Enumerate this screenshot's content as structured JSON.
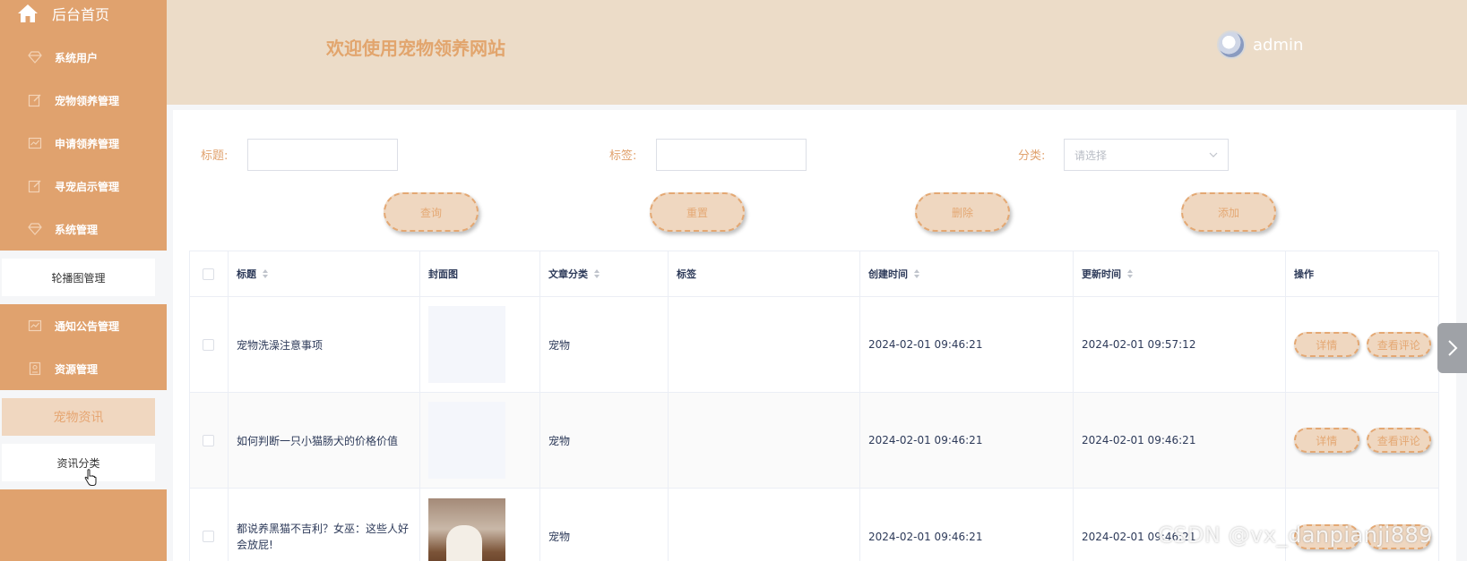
{
  "sidebar": {
    "home": "后台首页",
    "items": [
      {
        "label": "系统用户",
        "icon": "diamond-icon"
      },
      {
        "label": "宠物领养管理",
        "icon": "edit-icon"
      },
      {
        "label": "申请领养管理",
        "icon": "chart-icon"
      },
      {
        "label": "寻宠启示管理",
        "icon": "edit-icon"
      },
      {
        "label": "系统管理",
        "icon": "diamond-icon"
      },
      {
        "label": "通知公告管理",
        "icon": "chart-icon"
      },
      {
        "label": "资源管理",
        "icon": "badge-icon"
      }
    ],
    "sub_carousel": "轮播图管理",
    "sub_active": "宠物资讯",
    "sub_category": "资讯分类"
  },
  "header": {
    "title": "欢迎使用宠物领养网站",
    "username": "admin"
  },
  "filters": {
    "title_label": "标题:",
    "tag_label": "标签:",
    "category_label": "分类:",
    "category_placeholder": "请选择"
  },
  "buttons": {
    "query": "查询",
    "reset": "重置",
    "delete": "删除",
    "add": "添加"
  },
  "table": {
    "headers": {
      "title": "标题",
      "cover": "封面图",
      "category": "文章分类",
      "tags": "标签",
      "created": "创建时间",
      "updated": "更新时间",
      "actions": "操作"
    },
    "rows": [
      {
        "title": "宠物洗澡注意事项",
        "category": "宠物",
        "tags": "",
        "created": "2024-02-01 09:46:21",
        "updated": "2024-02-01 09:57:12",
        "detail": "详情",
        "comments": "查看评论"
      },
      {
        "title": "如何判断一只小猫肠犬的价格价值",
        "category": "宠物",
        "tags": "",
        "created": "2024-02-01 09:46:21",
        "updated": "2024-02-01 09:46:21",
        "detail": "详情",
        "comments": "查看评论"
      },
      {
        "title": "都说养黑猫不吉利？女巫：这些人好会放屁!",
        "category": "宠物",
        "tags": "",
        "created": "2024-02-01 09:46:21",
        "updated": "2024-02-01 09:46:21",
        "detail": "",
        "comments": ""
      }
    ]
  },
  "watermark": "CSDN @vx_danpianji889",
  "colors": {
    "sidebar": "#e0a26e",
    "header": "#ecdcc8",
    "accent": "#e4a873",
    "button_bg": "#efd7c0"
  }
}
